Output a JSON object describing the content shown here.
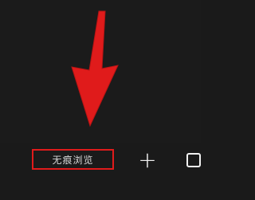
{
  "bottom_bar": {
    "tab_label": "无痕浏览",
    "new_tab_symbol": "+"
  },
  "annotation": {
    "arrow_color": "#e01b1b",
    "highlight_color": "#e01b1b"
  },
  "icons": [
    "arrow-down-icon",
    "plus-icon",
    "tabs-corner-icon"
  ]
}
